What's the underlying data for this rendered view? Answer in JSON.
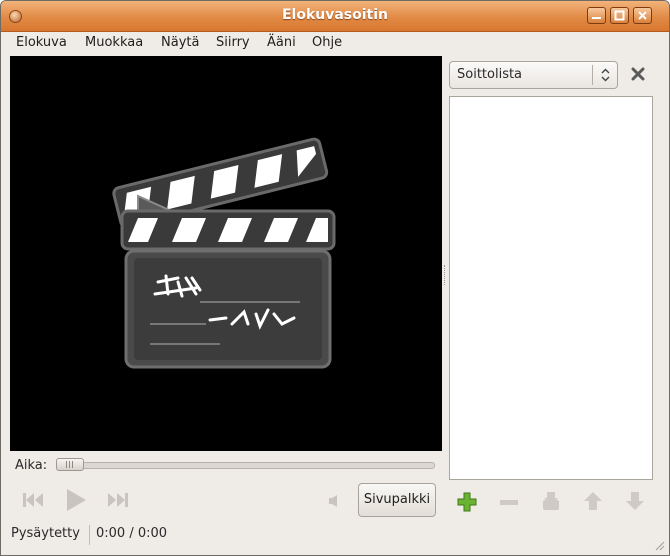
{
  "window": {
    "title": "Elokuvasoitin"
  },
  "menubar": {
    "items": [
      {
        "label": "Elokuva"
      },
      {
        "label": "Muokkaa"
      },
      {
        "label": "Näytä"
      },
      {
        "label": "Siirry"
      },
      {
        "label": "Ääni"
      },
      {
        "label": "Ohje"
      }
    ]
  },
  "sidebar": {
    "combo_value": "Soittolista",
    "toggle_button_label": "Sivupalkki"
  },
  "seek": {
    "label": "Aika:",
    "position_fraction": 0
  },
  "status": {
    "state": "Pysäytetty",
    "time": "0:00 / 0:00"
  },
  "colors": {
    "titlebar": "#e18a45",
    "window_bg": "#efebe7",
    "video_bg": "#000000",
    "add_icon": "#5aa02c"
  },
  "icons": {
    "video_placeholder": "clapperboard-icon",
    "playlist_add": "plus-icon",
    "playlist_remove": "minus-icon",
    "playlist_save": "save-icon",
    "move_up": "arrow-up-icon",
    "move_down": "arrow-down-icon"
  }
}
